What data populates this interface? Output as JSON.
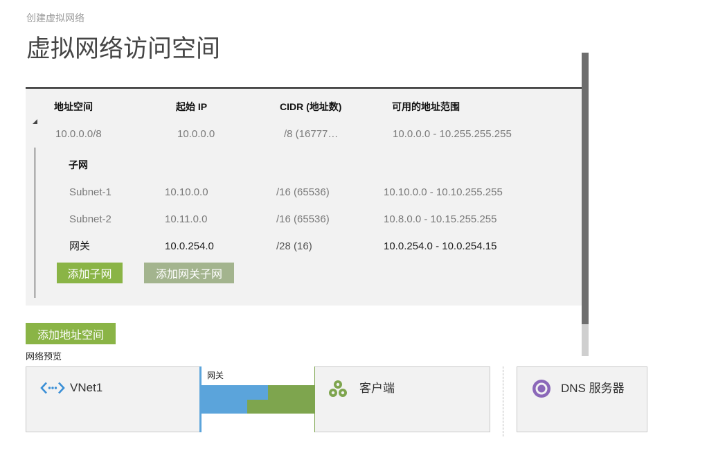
{
  "breadcrumb": "创建虚拟网络",
  "page_title": "虚拟网络访问空间",
  "address_table": {
    "headers": {
      "address_space": "地址空间",
      "start_ip": "起始 IP",
      "cidr": "CIDR (地址数)",
      "usable_range": "可用的地址范围"
    },
    "address_space": {
      "expanded": true,
      "toggle_icon": "expand-triangle-icon",
      "name": "10.0.0.0/8",
      "start_ip": "10.0.0.0",
      "cidr": "/8 (16777…",
      "usable_range": "10.0.0.0 - 10.255.255.255"
    },
    "subnets_heading": "子网",
    "subnets": [
      {
        "name": "Subnet-1",
        "start_ip": "10.10.0.0",
        "cidr": "/16 (65536)",
        "usable_range": "10.10.0.0 - 10.10.255.255"
      },
      {
        "name": "Subnet-2",
        "start_ip": "10.11.0.0",
        "cidr": "/16 (65536)",
        "usable_range": "10.8.0.0 - 10.15.255.255"
      },
      {
        "name": "网关",
        "start_ip": "10.0.254.0",
        "cidr": "/28 (16)",
        "usable_range": "10.0.254.0 - 10.0.254.15"
      }
    ],
    "add_subnet_button": "添加子网",
    "add_gateway_subnet_button": "添加网关子网"
  },
  "add_address_space_button": "添加地址空间",
  "preview": {
    "title": "网络预览",
    "vnet": {
      "label": "VNet1",
      "icon": "vnet-icon"
    },
    "gateway": {
      "label": "网关"
    },
    "client": {
      "label": "客户端",
      "icon": "client-group-icon"
    },
    "dns": {
      "label": "DNS 服务器",
      "icon": "dns-server-icon"
    }
  },
  "colors": {
    "accent_green": "#8ab446",
    "muted_button": "#a3b48e",
    "panel_background": "#f2f2f2",
    "vnet_blue": "#3a8fd6",
    "gateway_blue": "#5ba4db",
    "client_green": "#7ea54e",
    "dns_purple": "#8b68b9"
  }
}
